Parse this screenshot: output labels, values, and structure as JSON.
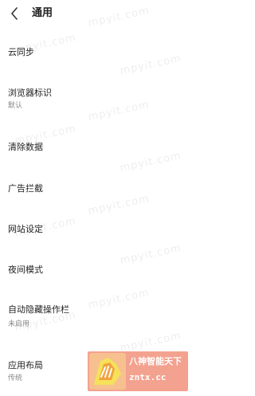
{
  "header": {
    "back_icon": "chevron-left-icon",
    "title": "通用"
  },
  "items": [
    {
      "title": "云同步",
      "subtitle": ""
    },
    {
      "title": "浏览器标识",
      "subtitle": "默认"
    },
    {
      "title": "清除数据",
      "subtitle": ""
    },
    {
      "title": "广告拦截",
      "subtitle": ""
    },
    {
      "title": "网站设定",
      "subtitle": ""
    },
    {
      "title": "夜间模式",
      "subtitle": ""
    },
    {
      "title": "自动隐藏操作栏",
      "subtitle": "未启用"
    },
    {
      "title": "应用布局",
      "subtitle": "传统"
    }
  ],
  "watermark": {
    "text": "mpyit.com"
  },
  "badge": {
    "line1": "八神智能天下",
    "line2": "zntx.cc",
    "color": "#f3a28f"
  }
}
